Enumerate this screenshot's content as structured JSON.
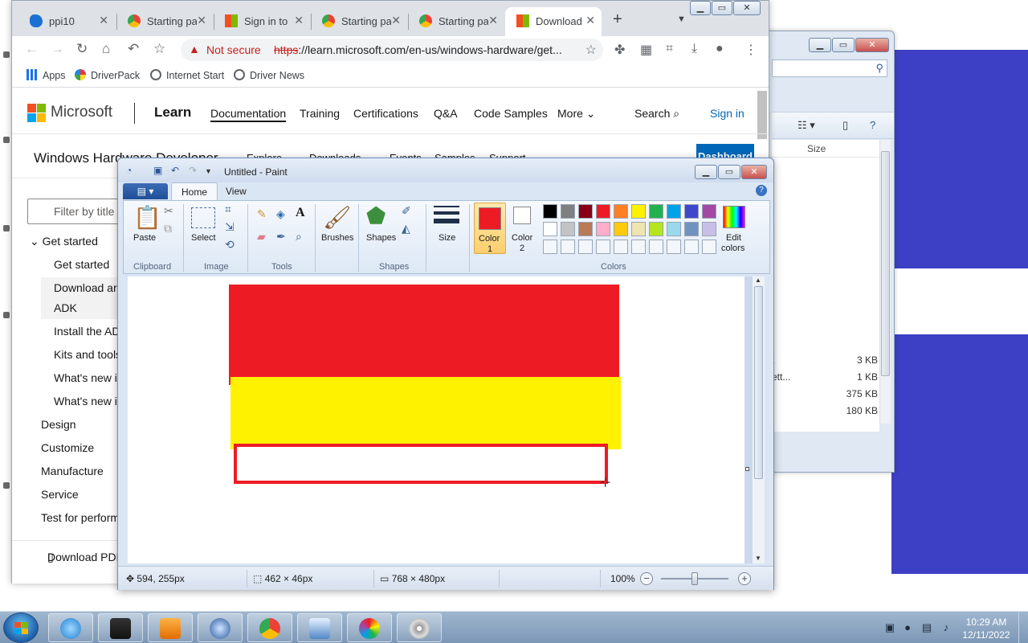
{
  "desktop": {
    "accent_color": "#3d3fc4",
    "explorer": {
      "size_column": "Size",
      "files": [
        {
          "name": "t",
          "size": "3 KB"
        },
        {
          "name": "ett...",
          "size": "1 KB"
        },
        {
          "name": "",
          "size": "375 KB"
        },
        {
          "name": "",
          "size": "180 KB"
        }
      ]
    }
  },
  "browser": {
    "tabs": [
      {
        "title": "ppi10",
        "icon": "edge-icon",
        "active": false
      },
      {
        "title": "Starting pa",
        "icon": "chrome-icon",
        "active": false
      },
      {
        "title": "Sign in to",
        "icon": "microsoft-icon",
        "active": false
      },
      {
        "title": "Starting pa",
        "icon": "chrome-icon",
        "active": false
      },
      {
        "title": "Starting pa",
        "icon": "chrome-icon",
        "active": false
      },
      {
        "title": "Download",
        "icon": "microsoft-icon",
        "active": true
      }
    ],
    "security_label": "Not secure",
    "url_scheme": "https",
    "url_rest": "://learn.microsoft.com/en-us/windows-hardware/get...",
    "bookmarks": [
      "Apps",
      "DriverPack",
      "Internet Start",
      "Driver News"
    ]
  },
  "page": {
    "brand": "Microsoft",
    "product": "Learn",
    "nav": [
      "Documentation",
      "Training",
      "Certifications",
      "Q&A",
      "Code Samples",
      "More"
    ],
    "search": "Search",
    "sign_in": "Sign in",
    "site_title": "Windows Hardware Developer",
    "subnav": [
      "Explore",
      "Downloads",
      "Events",
      "Samples",
      "Support"
    ],
    "dashboard": "Dashboard",
    "filter_placeholder": "Filter by title",
    "toc": {
      "get_started": "Get started",
      "children": [
        "Get started",
        "Download ar",
        "ADK",
        "Install the AD",
        "Kits and tools",
        "What's new i",
        "What's new i"
      ],
      "sections": [
        "Design",
        "Customize",
        "Manufacture",
        "Service",
        "Test for perform"
      ]
    },
    "download_pdf": "Download PDF"
  },
  "paint": {
    "title": "Untitled - Paint",
    "ribbon_tabs": [
      "Home",
      "View"
    ],
    "groups": {
      "clipboard": "Clipboard",
      "image": "Image",
      "tools": "Tools",
      "shapes": "Shapes",
      "colors": "Colors"
    },
    "buttons": {
      "paste": "Paste",
      "select": "Select",
      "brushes": "Brushes",
      "shapes": "Shapes",
      "size": "Size",
      "color1_line1": "Color",
      "color1_line2": "1",
      "color2_line1": "Color",
      "color2_line2": "2",
      "edit_colors_line1": "Edit",
      "edit_colors_line2": "colors"
    },
    "color1": "#ed1c24",
    "color2": "#ffffff",
    "palette_row1": [
      "#000000",
      "#7f7f7f",
      "#880015",
      "#ed1c24",
      "#ff7f27",
      "#fff200",
      "#22b14c",
      "#00a2e8",
      "#3f48cc",
      "#a349a4"
    ],
    "palette_row2": [
      "#ffffff",
      "#c3c3c3",
      "#b97a57",
      "#ffaec9",
      "#ffc90e",
      "#efe4b0",
      "#b5e61d",
      "#99d9ea",
      "#7092be",
      "#c8bfe7"
    ],
    "canvas": {
      "fill_red": "#ed1c24",
      "fill_yellow": "#fff200",
      "outline_red": "#ed1c24"
    },
    "status": {
      "cursor": "594, 255px",
      "selection": "462 × 46px",
      "canvas_size": "768 × 480px",
      "zoom": "100%",
      "zoom_level": 0.5
    }
  },
  "taskbar": {
    "apps": [
      "internet-explorer-icon",
      "media-icon",
      "player-icon",
      "network-icon",
      "chrome-icon",
      "remote-desktop-icon",
      "paint-icon",
      "dvd-icon"
    ],
    "time": "10:29 AM",
    "date": "12/11/2022"
  }
}
